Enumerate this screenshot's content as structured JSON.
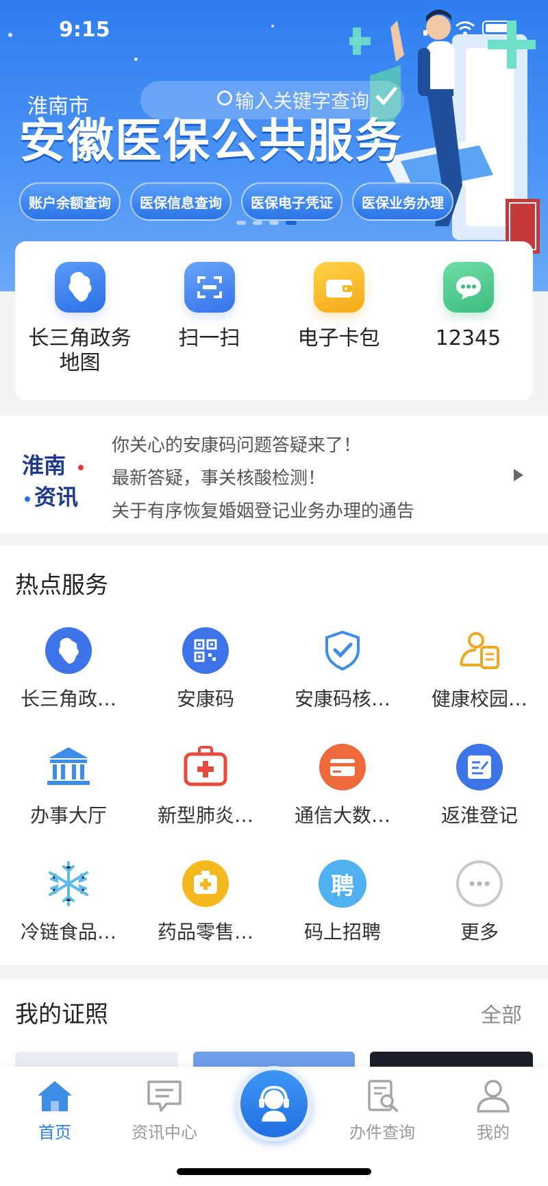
{
  "status": {
    "time": "9:15"
  },
  "header": {
    "city": "淮南市",
    "search_placeholder": "输入关键字查询"
  },
  "banner": {
    "title": "安徽医保公共服务",
    "pills": [
      "账户余额查询",
      "医保信息查询",
      "医保电子凭证",
      "医保业务办理"
    ]
  },
  "quick_actions": [
    {
      "label": "长三角政务地图",
      "icon": "map-icon",
      "color": "#3d7ef0"
    },
    {
      "label": "扫一扫",
      "icon": "scan-icon",
      "color": "#3d7ef0"
    },
    {
      "label": "电子卡包",
      "icon": "wallet-icon",
      "color": "#f5b81f"
    },
    {
      "label": "12345",
      "icon": "chat-icon",
      "color": "#43c28a"
    }
  ],
  "news": {
    "logo_line1": "淮南",
    "logo_line2": "资讯",
    "items": [
      "你关心的安康码问题答疑来了！",
      "最新答疑，事关核酸检测！",
      "关于有序恢复婚姻登记业务办理的通告"
    ]
  },
  "hot_services": {
    "title": "热点服务",
    "items": [
      {
        "label": "长三角政…",
        "icon": "map-icon"
      },
      {
        "label": "安康码",
        "icon": "qrcode-icon"
      },
      {
        "label": "安康码核…",
        "icon": "shield-check-icon"
      },
      {
        "label": "健康校园…",
        "icon": "person-card-icon"
      },
      {
        "label": "办事大厅",
        "icon": "government-building-icon"
      },
      {
        "label": "新型肺炎…",
        "icon": "medical-kit-icon"
      },
      {
        "label": "通信大数…",
        "icon": "card-icon"
      },
      {
        "label": "返淮登记",
        "icon": "edit-form-icon"
      },
      {
        "label": "冷链食品…",
        "icon": "snowflake-icon"
      },
      {
        "label": "药品零售…",
        "icon": "medicine-box-icon"
      },
      {
        "label": "码上招聘",
        "icon": "recruit-icon"
      },
      {
        "label": "更多",
        "icon": "more-icon"
      }
    ],
    "recruit_glyph": "聘"
  },
  "certificates": {
    "title": "我的证照",
    "all_label": "全部"
  },
  "tabbar": {
    "items": [
      {
        "label": "首页",
        "icon": "home-icon",
        "active": true
      },
      {
        "label": "资讯中心",
        "icon": "message-icon",
        "active": false
      },
      {
        "label": "办件查询",
        "icon": "document-search-icon",
        "active": false
      },
      {
        "label": "我的",
        "icon": "user-icon",
        "active": false
      }
    ]
  },
  "colors": {
    "primary": "#2f7df0",
    "banner_top": "#2f7df0"
  }
}
